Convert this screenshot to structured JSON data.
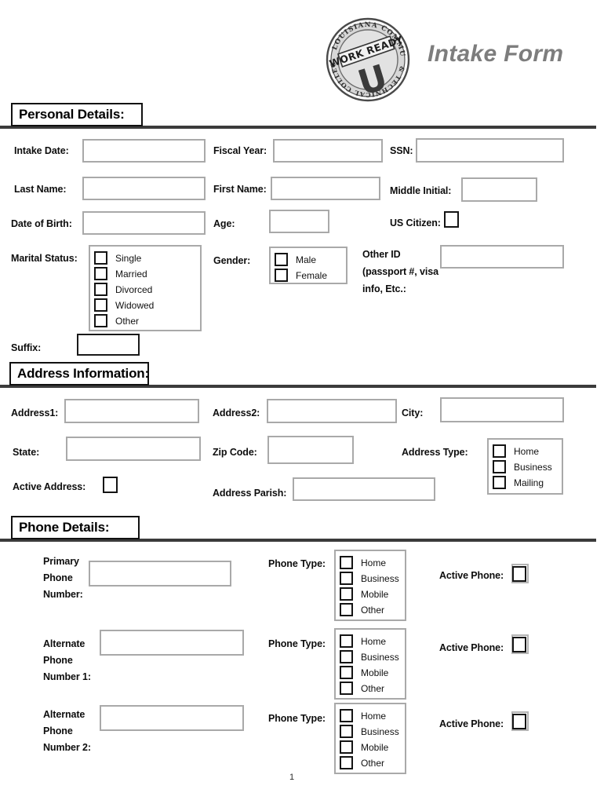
{
  "document": {
    "title": "Intake Form",
    "page_number": "1",
    "logo": {
      "name": "lctcs-work-ready-u-seal",
      "rim_text_top": "LOUISIANA COMMUNITY",
      "rim_text_bottom": "& TECHNICAL COLLEGE SYSTEM",
      "banner_text": "WORK READY",
      "monogram": "U"
    }
  },
  "sections": {
    "personal": {
      "heading": "Personal Details:",
      "fields": {
        "intake_date": {
          "label": "Intake Date:",
          "value": "",
          "placeholder": ""
        },
        "fiscal_year": {
          "label": "Fiscal Year:",
          "value": "",
          "placeholder": ""
        },
        "ssn": {
          "label": "SSN:",
          "value": "",
          "placeholder": ""
        },
        "last_name": {
          "label": "Last Name:",
          "value": "",
          "placeholder": ""
        },
        "first_name": {
          "label": "First Name:",
          "value": "",
          "placeholder": ""
        },
        "middle_initial": {
          "label": "Middle Initial:",
          "value": "",
          "placeholder": ""
        },
        "date_of_birth": {
          "label": "Date of Birth:",
          "value": "",
          "placeholder": ""
        },
        "age": {
          "label": "Age:",
          "value": "",
          "placeholder": ""
        },
        "us_citizen": {
          "label": "US Citizen:",
          "checked": false
        },
        "marital_status": {
          "label": "Marital Status:",
          "options": [
            {
              "label": "Single",
              "checked": false
            },
            {
              "label": "Married",
              "checked": false
            },
            {
              "label": "Divorced",
              "checked": false
            },
            {
              "label": "Widowed",
              "checked": false
            },
            {
              "label": "Other",
              "checked": false
            }
          ]
        },
        "gender": {
          "label": "Gender:",
          "options": [
            {
              "label": "Male",
              "checked": false
            },
            {
              "label": "Female",
              "checked": false
            }
          ]
        },
        "other_id": {
          "label_line1": "Other ID",
          "label_line2": "(passport #, visa",
          "label_line3": "info, Etc.:",
          "value": "",
          "placeholder": ""
        },
        "suffix": {
          "label": "Suffix:",
          "value": "",
          "placeholder": ""
        }
      }
    },
    "address": {
      "heading": "Address Information:",
      "fields": {
        "address1": {
          "label": "Address1:",
          "value": "",
          "placeholder": ""
        },
        "address2": {
          "label": "Address2:",
          "value": "",
          "placeholder": ""
        },
        "city": {
          "label": "City:",
          "value": "",
          "placeholder": ""
        },
        "state": {
          "label": "State:",
          "value": "",
          "placeholder": ""
        },
        "zip_code": {
          "label": "Zip Code:",
          "value": "",
          "placeholder": ""
        },
        "address_type": {
          "label": "Address Type:",
          "options": [
            {
              "label": "Home",
              "checked": false
            },
            {
              "label": "Business",
              "checked": false
            },
            {
              "label": "Mailing",
              "checked": false
            }
          ]
        },
        "active_address": {
          "label": "Active Address:",
          "checked": false
        },
        "address_parish": {
          "label": "Address Parish:",
          "value": "",
          "placeholder": ""
        }
      }
    },
    "phone": {
      "heading": "Phone Details:",
      "rows": [
        {
          "label_line1": "Primary",
          "label_line2": "Phone",
          "label_line3": "Number:",
          "value": "",
          "type_label": "Phone Type:",
          "type_options": [
            {
              "label": "Home",
              "checked": false
            },
            {
              "label": "Business",
              "checked": false
            },
            {
              "label": "Mobile",
              "checked": false
            },
            {
              "label": "Other",
              "checked": false
            }
          ],
          "active_label": "Active Phone:",
          "active_checked": false
        },
        {
          "label_line1": "Alternate",
          "label_line2": "Phone",
          "label_line3": "Number 1:",
          "value": "",
          "type_label": "Phone Type:",
          "type_options": [
            {
              "label": "Home",
              "checked": false
            },
            {
              "label": "Business",
              "checked": false
            },
            {
              "label": "Mobile",
              "checked": false
            },
            {
              "label": "Other",
              "checked": false
            }
          ],
          "active_label": "Active Phone:",
          "active_checked": false
        },
        {
          "label_line1": "Alternate",
          "label_line2": "Phone",
          "label_line3": "Number 2:",
          "value": "",
          "type_label": "Phone Type:",
          "type_options": [
            {
              "label": "Home",
              "checked": false
            },
            {
              "label": "Business",
              "checked": false
            },
            {
              "label": "Mobile",
              "checked": false
            },
            {
              "label": "Other",
              "checked": false
            }
          ],
          "active_label": "Active Phone:",
          "active_checked": false
        }
      ]
    }
  },
  "colors": {
    "title_gray": "#7d7d7d",
    "input_border": "#a9a9a9",
    "checkbox_border": "#141414",
    "rule_dark": "#3b3b3b",
    "text": "#111111"
  }
}
